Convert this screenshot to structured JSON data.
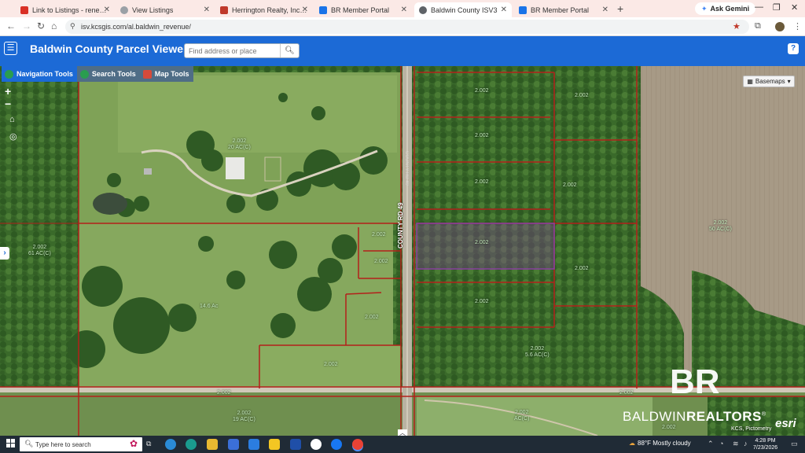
{
  "browser": {
    "tabs": [
      {
        "title": "Link to Listings - reneedonedr",
        "icon_color": "#d93025",
        "icon": "gmail-icon",
        "active": false
      },
      {
        "title": "View Listings",
        "icon_color": "#9aa0a6",
        "icon": "globe-icon",
        "active": false
      },
      {
        "title": "Herrington Realty, Inc. - Search",
        "icon_color": "#c0392b",
        "icon": "site-icon",
        "active": false
      },
      {
        "title": "BR Member Portal",
        "icon_color": "#1a73e8",
        "icon": "portal-icon",
        "active": false
      },
      {
        "title": "Baldwin County ISV3",
        "icon_color": "#5f6368",
        "icon": "globe-icon",
        "active": true
      },
      {
        "title": "BR Member Portal",
        "icon_color": "#1a73e8",
        "icon": "portal-icon",
        "active": false
      }
    ],
    "new_tab": "+",
    "ask_gemini": "Ask Gemini",
    "url": "isv.kcsgis.com/al.baldwin_revenue/"
  },
  "app": {
    "menu_icon": "☰",
    "title": "Baldwin County Parcel Viewer",
    "search_placeholder": "Find address or place",
    "help": "?"
  },
  "toolbar": {
    "navigation": "Navigation Tools",
    "search": "Search Tools",
    "map": "Map Tools"
  },
  "map": {
    "zoom_in": "+",
    "zoom_out": "−",
    "basemaps": "Basemaps",
    "road_label": "COUNTY RD 49",
    "road_label_faint": "COUNTY RD 49",
    "parcel_labels": [
      {
        "text": "2.002",
        "sub": ""
      },
      {
        "text": "2.002",
        "sub": ""
      },
      {
        "text": "2.002",
        "sub": ""
      },
      {
        "text": "2.002",
        "sub": ""
      },
      {
        "text": "2.002",
        "sub": ""
      },
      {
        "text": "2.002",
        "sub": ""
      },
      {
        "text": "2.002",
        "sub": ""
      },
      {
        "text": "2.002",
        "sub": ""
      },
      {
        "text": "2.002",
        "sub": "20 AC(C)"
      },
      {
        "text": "2.002",
        "sub": "61 AC(C)"
      },
      {
        "text": "2.002",
        "sub": "50 AC(C)"
      },
      {
        "text": "",
        "sub": "14.6 Ac"
      },
      {
        "text": "2.002",
        "sub": ""
      },
      {
        "text": "2.002",
        "sub": ""
      },
      {
        "text": "2.002",
        "sub": ""
      },
      {
        "text": "2.002",
        "sub": "5.6 AC(C)"
      },
      {
        "text": "2.002",
        "sub": ""
      },
      {
        "text": "2.002",
        "sub": ""
      },
      {
        "text": "2.002",
        "sub": "19 AC(C)"
      },
      {
        "text": "2.002",
        "sub": ""
      },
      {
        "text": "2.002",
        "sub": "AC(C)"
      },
      {
        "text": "2.002",
        "sub": ""
      }
    ],
    "brokerage_a": "BALDWIN",
    "brokerage_b": "REALTORS",
    "brokerage_mark": "®",
    "logo_text": "BR",
    "esri": "esri",
    "attribution": "KCS, Pictometry"
  },
  "taskbar": {
    "search_placeholder": "Type here to search",
    "weather": "88°F  Mostly cloudy",
    "time": "4:28 PM",
    "date": "7/23/2026"
  },
  "colors": {
    "header_blue": "#1c6ad6",
    "parcel_line": "#b3201a",
    "selected_parcel": "#8a3fa0",
    "taskbar": "#202b36"
  }
}
